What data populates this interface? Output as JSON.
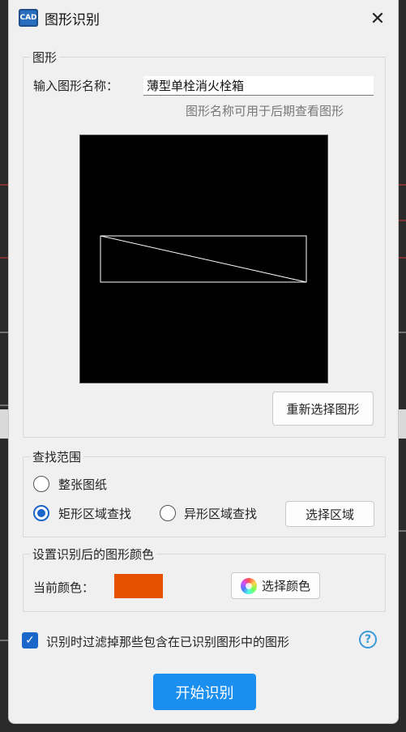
{
  "window": {
    "app_icon_text": "CAD",
    "title": "图形识别",
    "close_glyph": "✕"
  },
  "shape_group": {
    "title": "图形",
    "name_label": "输入图形名称：",
    "name_value": "薄型单栓消火栓箱",
    "hint": "图形名称可用于后期查看图形",
    "reselect_button": "重新选择图形"
  },
  "search_group": {
    "title": "查找范围",
    "options": [
      {
        "label": "整张图纸",
        "checked": false
      },
      {
        "label": "矩形区域查找",
        "checked": true
      },
      {
        "label": "异形区域查找",
        "checked": false
      }
    ],
    "select_area_button": "选择区域"
  },
  "color_group": {
    "title": "设置识别后的图形颜色",
    "current_label": "当前颜色：",
    "current_color": "#e65100",
    "choose_color_button": "选择颜色"
  },
  "filter_checkbox": {
    "checked": true,
    "label": "识别时过滤掉那些包含在已识别图形中的图形"
  },
  "help_glyph": "?",
  "start_button": "开始识别",
  "colors": {
    "accent": "#1a8ff0",
    "radio_checked": "#1a66c9",
    "preview_background": "#000000"
  }
}
